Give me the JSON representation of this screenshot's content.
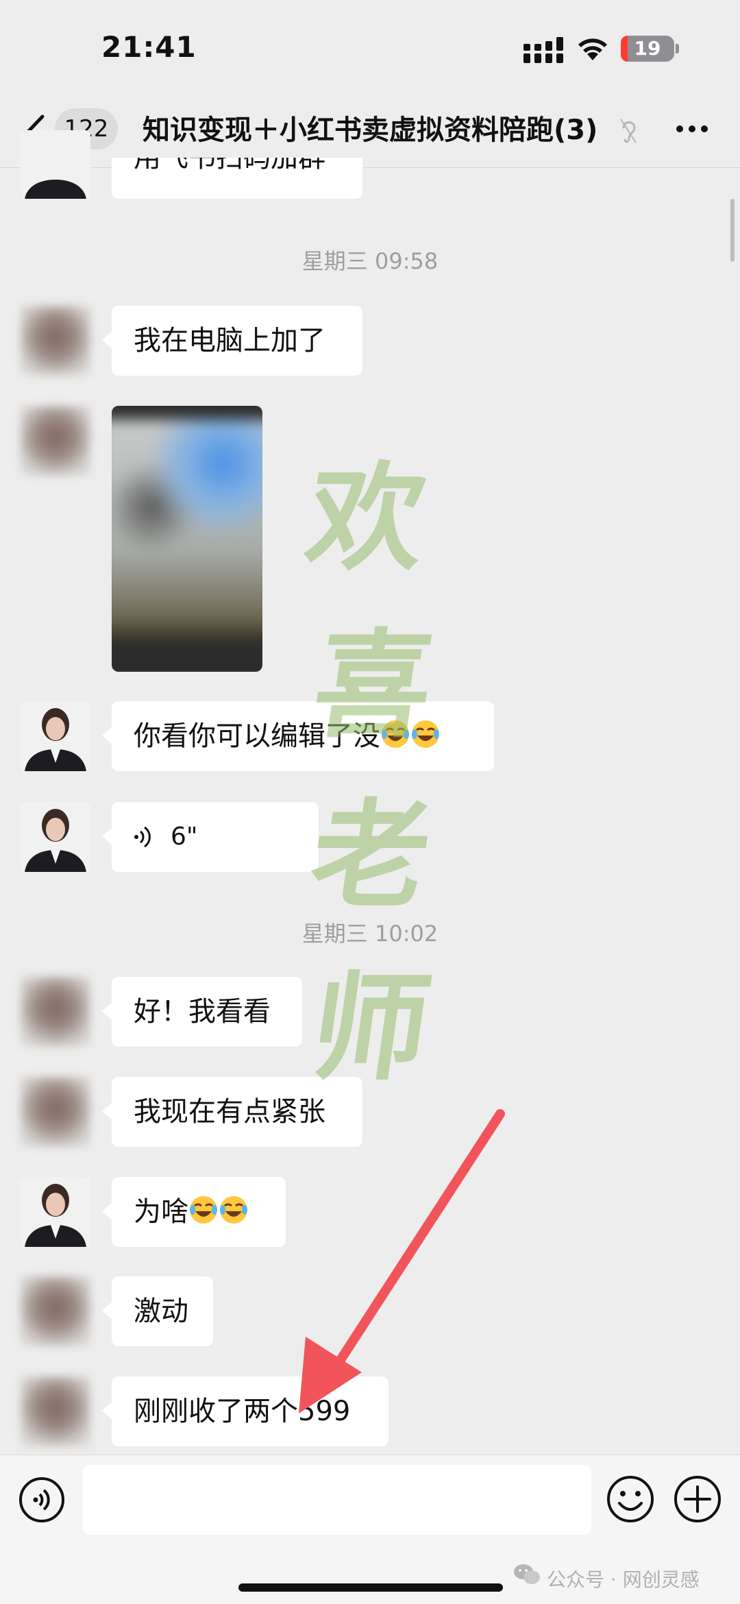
{
  "status_bar": {
    "time": "21:41",
    "battery": "19"
  },
  "nav": {
    "unread_count": "122",
    "title": "知识变现＋小红书卖虚拟资料陪跑(3)"
  },
  "messages": {
    "partial_top": "用飞书扫码加群",
    "timestamp_1": "星期三 09:58",
    "m1": "我在电脑上加了",
    "m3": "你看你可以编辑了没",
    "voice_duration": "6\"",
    "timestamp_2": "星期三 10:02",
    "m5": "好！我看看",
    "m6": "我现在有点紧张",
    "m7": "为啥",
    "m8": "激动",
    "m9": "刚刚收了两个599"
  },
  "watermark": [
    "欢",
    "喜",
    "老",
    "师"
  ],
  "footer": {
    "source": "公众号 · 网创灵感"
  },
  "colors": {
    "background": "#EDEDED",
    "bubble": "#FFFFFF",
    "arrow": "#F2545B",
    "watermark": "#96BE6E"
  },
  "icons": [
    "back-icon",
    "muted-icon",
    "more-icon",
    "voice-message-icon",
    "voice-toggle-icon",
    "emoji-icon",
    "plus-icon",
    "wechat-icon"
  ]
}
